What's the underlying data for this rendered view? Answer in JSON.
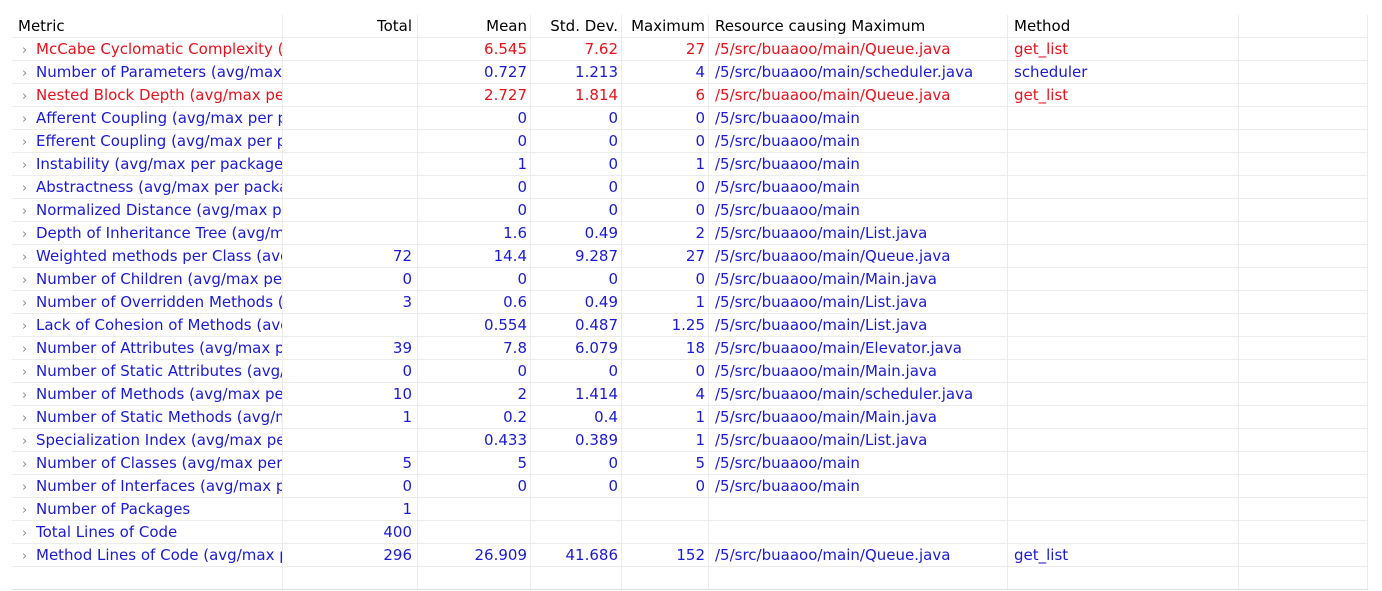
{
  "columns": {
    "metric": "Metric",
    "total": "Total",
    "mean": "Mean",
    "std": "Std. Dev.",
    "max": "Maximum",
    "resource": "Resource causing Maximum",
    "method": "Method"
  },
  "icons": {
    "expand": "chevron-right-icon"
  },
  "colors": {
    "normal": "#1a1ad6",
    "warning": "#e8111c",
    "header": "#000000"
  },
  "rows": [
    {
      "metric": "McCabe Cyclomatic Complexity (a",
      "total": "",
      "mean": "6.545",
      "std": "7.62",
      "max": "27",
      "resource": "/5/src/buaaoo/main/Queue.java",
      "method": "get_list",
      "warning": true
    },
    {
      "metric": "Number of Parameters (avg/max p",
      "total": "",
      "mean": "0.727",
      "std": "1.213",
      "max": "4",
      "resource": "/5/src/buaaoo/main/scheduler.java",
      "method": "scheduler",
      "warning": false
    },
    {
      "metric": "Nested Block Depth (avg/max per",
      "total": "",
      "mean": "2.727",
      "std": "1.814",
      "max": "6",
      "resource": "/5/src/buaaoo/main/Queue.java",
      "method": "get_list",
      "warning": true
    },
    {
      "metric": "Afferent Coupling (avg/max per p",
      "total": "",
      "mean": "0",
      "std": "0",
      "max": "0",
      "resource": "/5/src/buaaoo/main",
      "method": "",
      "warning": false
    },
    {
      "metric": "Efferent Coupling (avg/max per pa",
      "total": "",
      "mean": "0",
      "std": "0",
      "max": "0",
      "resource": "/5/src/buaaoo/main",
      "method": "",
      "warning": false
    },
    {
      "metric": "Instability (avg/max per packageFr",
      "total": "",
      "mean": "1",
      "std": "0",
      "max": "1",
      "resource": "/5/src/buaaoo/main",
      "method": "",
      "warning": false
    },
    {
      "metric": "Abstractness (avg/max per packag",
      "total": "",
      "mean": "0",
      "std": "0",
      "max": "0",
      "resource": "/5/src/buaaoo/main",
      "method": "",
      "warning": false
    },
    {
      "metric": "Normalized Distance (avg/max pe",
      "total": "",
      "mean": "0",
      "std": "0",
      "max": "0",
      "resource": "/5/src/buaaoo/main",
      "method": "",
      "warning": false
    },
    {
      "metric": "Depth of Inheritance Tree (avg/ma",
      "total": "",
      "mean": "1.6",
      "std": "0.49",
      "max": "2",
      "resource": "/5/src/buaaoo/main/List.java",
      "method": "",
      "warning": false
    },
    {
      "metric": "Weighted methods per Class (avg",
      "total": "72",
      "mean": "14.4",
      "std": "9.287",
      "max": "27",
      "resource": "/5/src/buaaoo/main/Queue.java",
      "method": "",
      "warning": false
    },
    {
      "metric": "Number of Children (avg/max per",
      "total": "0",
      "mean": "0",
      "std": "0",
      "max": "0",
      "resource": "/5/src/buaaoo/main/Main.java",
      "method": "",
      "warning": false
    },
    {
      "metric": "Number of Overridden Methods (",
      "total": "3",
      "mean": "0.6",
      "std": "0.49",
      "max": "1",
      "resource": "/5/src/buaaoo/main/List.java",
      "method": "",
      "warning": false
    },
    {
      "metric": "Lack of Cohesion of Methods (avg",
      "total": "",
      "mean": "0.554",
      "std": "0.487",
      "max": "1.25",
      "resource": "/5/src/buaaoo/main/List.java",
      "method": "",
      "warning": false
    },
    {
      "metric": "Number of Attributes (avg/max pe",
      "total": "39",
      "mean": "7.8",
      "std": "6.079",
      "max": "18",
      "resource": "/5/src/buaaoo/main/Elevator.java",
      "method": "",
      "warning": false
    },
    {
      "metric": "Number of Static Attributes (avg/r",
      "total": "0",
      "mean": "0",
      "std": "0",
      "max": "0",
      "resource": "/5/src/buaaoo/main/Main.java",
      "method": "",
      "warning": false
    },
    {
      "metric": "Number of Methods (avg/max per",
      "total": "10",
      "mean": "2",
      "std": "1.414",
      "max": "4",
      "resource": "/5/src/buaaoo/main/scheduler.java",
      "method": "",
      "warning": false
    },
    {
      "metric": "Number of Static Methods (avg/m",
      "total": "1",
      "mean": "0.2",
      "std": "0.4",
      "max": "1",
      "resource": "/5/src/buaaoo/main/Main.java",
      "method": "",
      "warning": false
    },
    {
      "metric": "Specialization Index (avg/max per",
      "total": "",
      "mean": "0.433",
      "std": "0.389",
      "max": "1",
      "resource": "/5/src/buaaoo/main/List.java",
      "method": "",
      "warning": false
    },
    {
      "metric": "Number of Classes (avg/max per p",
      "total": "5",
      "mean": "5",
      "std": "0",
      "max": "5",
      "resource": "/5/src/buaaoo/main",
      "method": "",
      "warning": false
    },
    {
      "metric": "Number of Interfaces (avg/max pe",
      "total": "0",
      "mean": "0",
      "std": "0",
      "max": "0",
      "resource": "/5/src/buaaoo/main",
      "method": "",
      "warning": false
    },
    {
      "metric": "Number of Packages",
      "total": "1",
      "mean": "",
      "std": "",
      "max": "",
      "resource": "",
      "method": "",
      "warning": false
    },
    {
      "metric": "Total Lines of Code",
      "total": "400",
      "mean": "",
      "std": "",
      "max": "",
      "resource": "",
      "method": "",
      "warning": false
    },
    {
      "metric": "Method Lines of Code (avg/max p",
      "total": "296",
      "mean": "26.909",
      "std": "41.686",
      "max": "152",
      "resource": "/5/src/buaaoo/main/Queue.java",
      "method": "get_list",
      "warning": false
    }
  ]
}
